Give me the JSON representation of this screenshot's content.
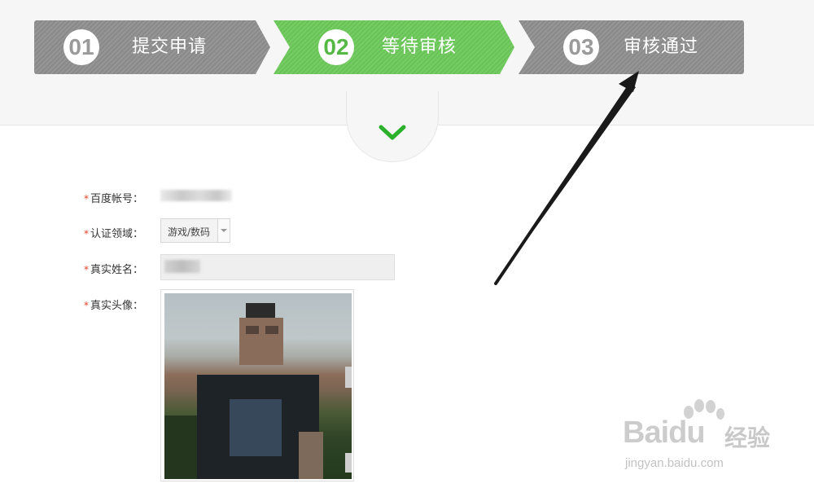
{
  "steps": [
    {
      "number": "01",
      "label": "提交申请",
      "state": "done"
    },
    {
      "number": "02",
      "label": "等待审核",
      "state": "current"
    },
    {
      "number": "03",
      "label": "审核通过",
      "state": "pending"
    }
  ],
  "colors": {
    "step_inactive": "#8f8f8f",
    "step_active": "#6cca5a",
    "chevron": "#2bb02b",
    "required_mark": "#e0452a",
    "arrow": "#1a1a1a"
  },
  "icons": {
    "down": "chevron-down-icon",
    "select": "caret-down-icon",
    "watermark": "baidu-paw-icon"
  },
  "form": {
    "required_mark": "*",
    "account": {
      "label": "百度帐号："
    },
    "domain": {
      "label": "认证领域：",
      "value": "游戏/数码"
    },
    "real_name": {
      "label": "真实姓名："
    },
    "avatar": {
      "label": "真实头像："
    }
  },
  "watermark": {
    "brand": "Bai",
    "brand2": "du",
    "product": "经验",
    "url": "jingyan.baidu.com"
  }
}
